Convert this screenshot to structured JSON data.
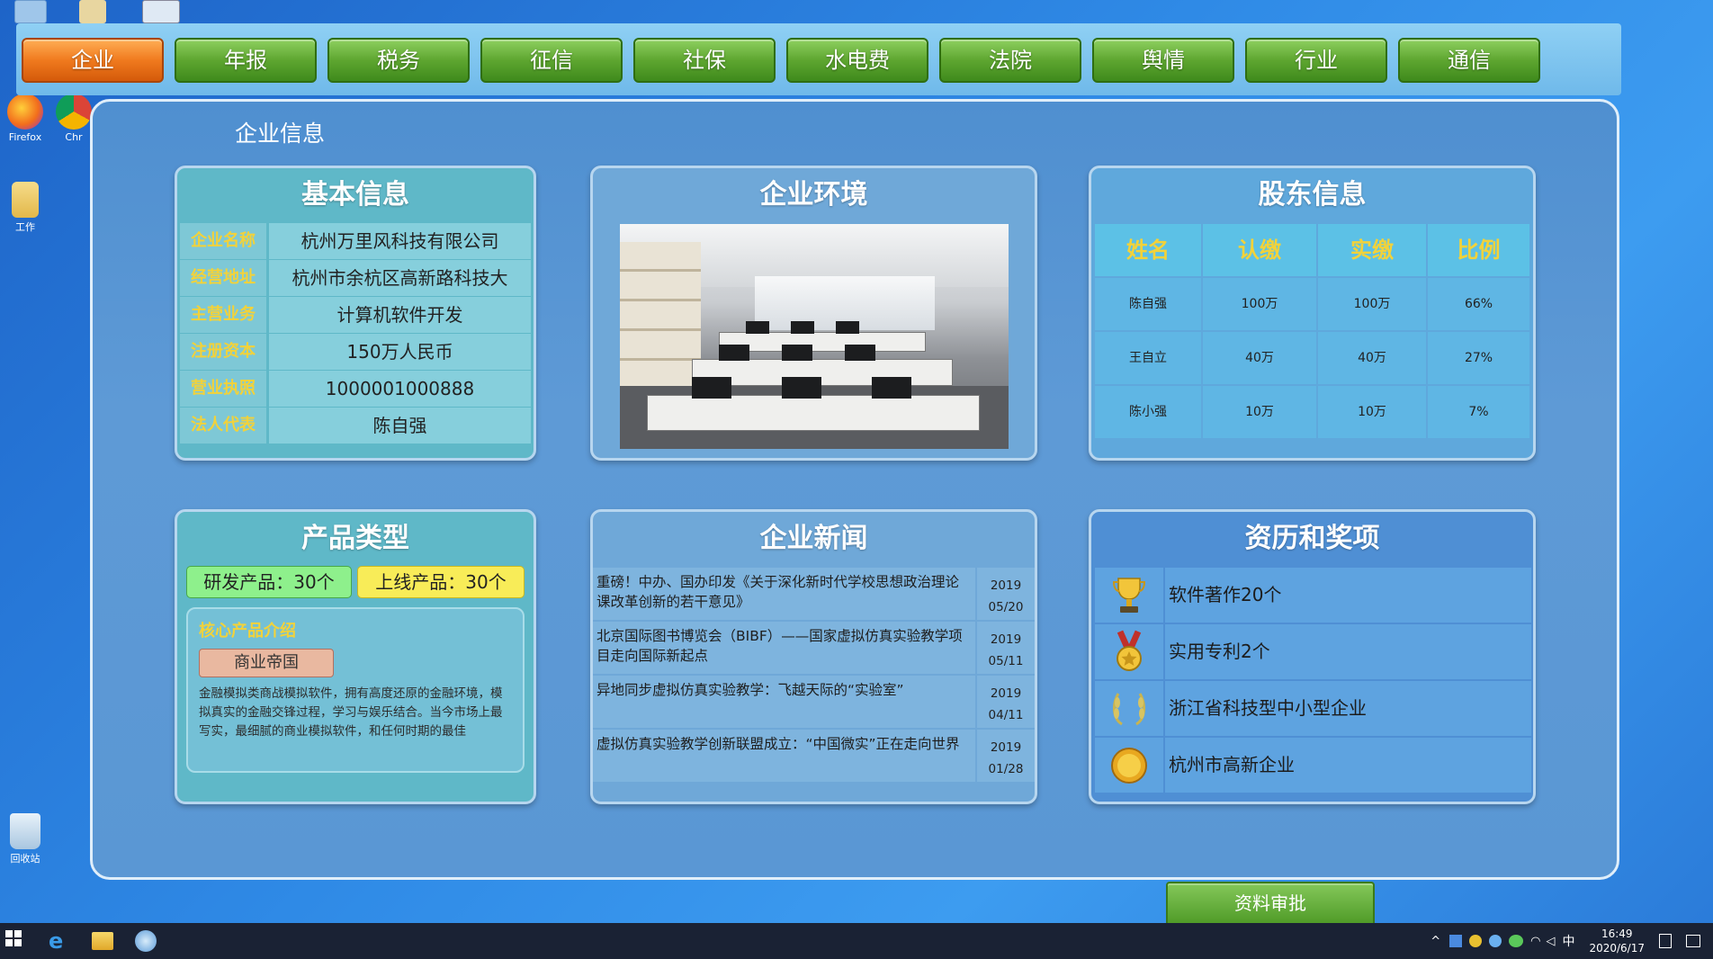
{
  "desktop": {
    "icons": [
      {
        "label": "Firefox"
      },
      {
        "label": "Chr"
      },
      {
        "label": "工作"
      },
      {
        "label": "回收站"
      }
    ]
  },
  "nav": {
    "tabs": [
      {
        "label": "企业",
        "active": true
      },
      {
        "label": "年报"
      },
      {
        "label": "税务"
      },
      {
        "label": "征信"
      },
      {
        "label": "社保"
      },
      {
        "label": "水电费"
      },
      {
        "label": "法院"
      },
      {
        "label": "舆情"
      },
      {
        "label": "行业"
      },
      {
        "label": "通信"
      }
    ]
  },
  "panel": {
    "title": "企业信息"
  },
  "basic": {
    "title": "基本信息",
    "rows": [
      {
        "key": "企业名称",
        "value": "杭州万里风科技有限公司"
      },
      {
        "key": "经营地址",
        "value": "杭州市余杭区高新路科技大"
      },
      {
        "key": "主营业务",
        "value": "计算机软件开发"
      },
      {
        "key": "注册资本",
        "value": "150万人民币"
      },
      {
        "key": "营业执照",
        "value": "1000001000888"
      },
      {
        "key": "法人代表",
        "value": "陈自强"
      }
    ]
  },
  "environment": {
    "title": "企业环境",
    "image": "office-photo"
  },
  "shareholders": {
    "title": "股东信息",
    "headers": [
      "姓名",
      "认缴",
      "实缴",
      "比例"
    ],
    "rows": [
      [
        "陈自强",
        "100万",
        "100万",
        "66%"
      ],
      [
        "王自立",
        "40万",
        "40万",
        "27%"
      ],
      [
        "陈小强",
        "10万",
        "10万",
        "7%"
      ]
    ]
  },
  "products": {
    "title": "产品类型",
    "rd_badge": "研发产品：30个",
    "online_badge": "上线产品：30个",
    "core_title": "核心产品介绍",
    "core_product": "商业帝国",
    "core_desc": "金融模拟类商战模拟软件，拥有高度还原的金融环境，模拟真实的金融交锋过程，学习与娱乐结合。当今市场上最写实，最细腻的商业模拟软件，和任何时期的最佳"
  },
  "news": {
    "title": "企业新闻",
    "items": [
      {
        "text": "重磅！中办、国办印发《关于深化新时代学校思想政治理论课改革创新的若干意见》",
        "year": "2019",
        "date": "05/20"
      },
      {
        "text": "北京国际图书博览会（BIBF）——国家虚拟仿真实验教学项目走向国际新起点",
        "year": "2019",
        "date": "05/11"
      },
      {
        "text": "异地同步虚拟仿真实验教学：飞越天际的“实验室”",
        "year": "2019",
        "date": "04/11"
      },
      {
        "text": "虚拟仿真实验教学创新联盟成立：“中国微实”正在走向世界",
        "year": "2019",
        "date": "01/28"
      }
    ]
  },
  "awards": {
    "title": "资历和奖项",
    "items": [
      {
        "icon": "trophy-icon",
        "label": "软件著作20个"
      },
      {
        "icon": "medal-icon",
        "label": "实用专利2个"
      },
      {
        "icon": "laurel-icon",
        "label": "浙江省科技型中小型企业"
      },
      {
        "icon": "gold-coin-icon",
        "label": "杭州市高新企业"
      }
    ]
  },
  "approve_button": "资料审批",
  "taskbar": {
    "ime": "中",
    "time": "16:49",
    "date": "2020/6/17"
  },
  "colors": {
    "tab_active": "#f07a1e",
    "tab_default": "#5ea630",
    "label_gold": "#f2d23a"
  }
}
